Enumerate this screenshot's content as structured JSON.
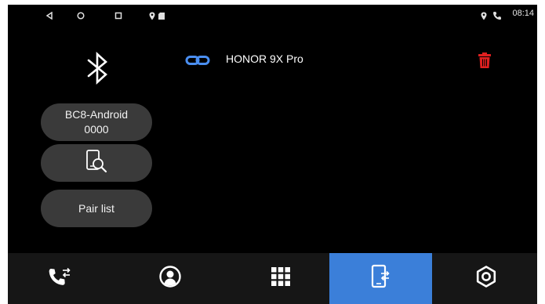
{
  "status_bar": {
    "time": "08:14",
    "icons": [
      "back-icon",
      "home-icon",
      "recents-icon",
      "location-icon",
      "sd-card-icon",
      "location-icon",
      "phone-call-icon"
    ]
  },
  "bluetooth": {
    "device_name": "BC8-Android",
    "pin": "0000",
    "pair_list_label": "Pair list",
    "search_icon": "phone-search-icon"
  },
  "paired_device": {
    "name": "HONOR 9X Pro",
    "link_icon": "link-icon",
    "delete_icon": "trash-icon"
  },
  "colors": {
    "background": "#000000",
    "pill": "#3a3a3a",
    "active_tab": "#3b7fd9",
    "link": "#4a8ef0",
    "delete": "#e02020"
  },
  "nav": {
    "items": [
      "dialer-icon",
      "contacts-icon",
      "keypad-icon",
      "bluetooth-devices-icon",
      "settings-icon"
    ],
    "active_index": 3
  }
}
